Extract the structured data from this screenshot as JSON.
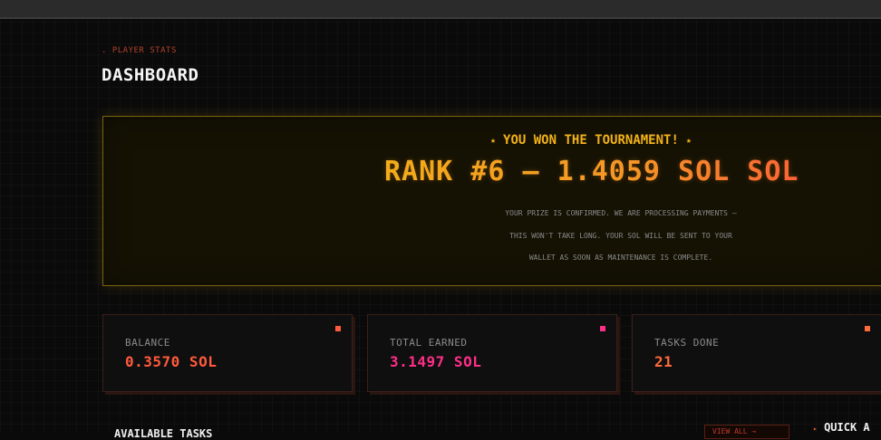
{
  "header": {
    "eyebrow": ". PLAYER STATS",
    "title": "DASHBOARD"
  },
  "banner": {
    "star": "★",
    "headline": "YOU WON THE TOURNAMENT!",
    "rank_line": "RANK #6 — 1.4059 SOL SOL",
    "message_lines": [
      "YOUR PRIZE IS CONFIRMED. WE ARE PROCESSING PAYMENTS —",
      "THIS WON'T TAKE LONG. YOUR SOL WILL BE SENT TO YOUR",
      "WALLET AS SOON AS MAINTENANCE IS COMPLETE."
    ]
  },
  "stats": [
    {
      "label": "BALANCE",
      "value": "0.3570 SOL",
      "color": "#ff5a3c",
      "dot_color": "#ff5a3c"
    },
    {
      "label": "TOTAL EARNED",
      "value": "3.1497 SOL",
      "color": "#ff2e88",
      "dot_color": "#ff2e88"
    },
    {
      "label": "TASKS DONE",
      "value": "21",
      "color": "#ff6a3c",
      "dot_color": "#ff6a3c"
    }
  ],
  "tasks_section": {
    "title": "AVAILABLE TASKS",
    "view_all": "VIEW ALL →"
  },
  "quick_actions": {
    "arrow": "▸",
    "title": "QUICK A"
  },
  "colors": {
    "background": "#0a0a0a",
    "gold": "#f3b21a",
    "accent": "#ff5a3c"
  }
}
